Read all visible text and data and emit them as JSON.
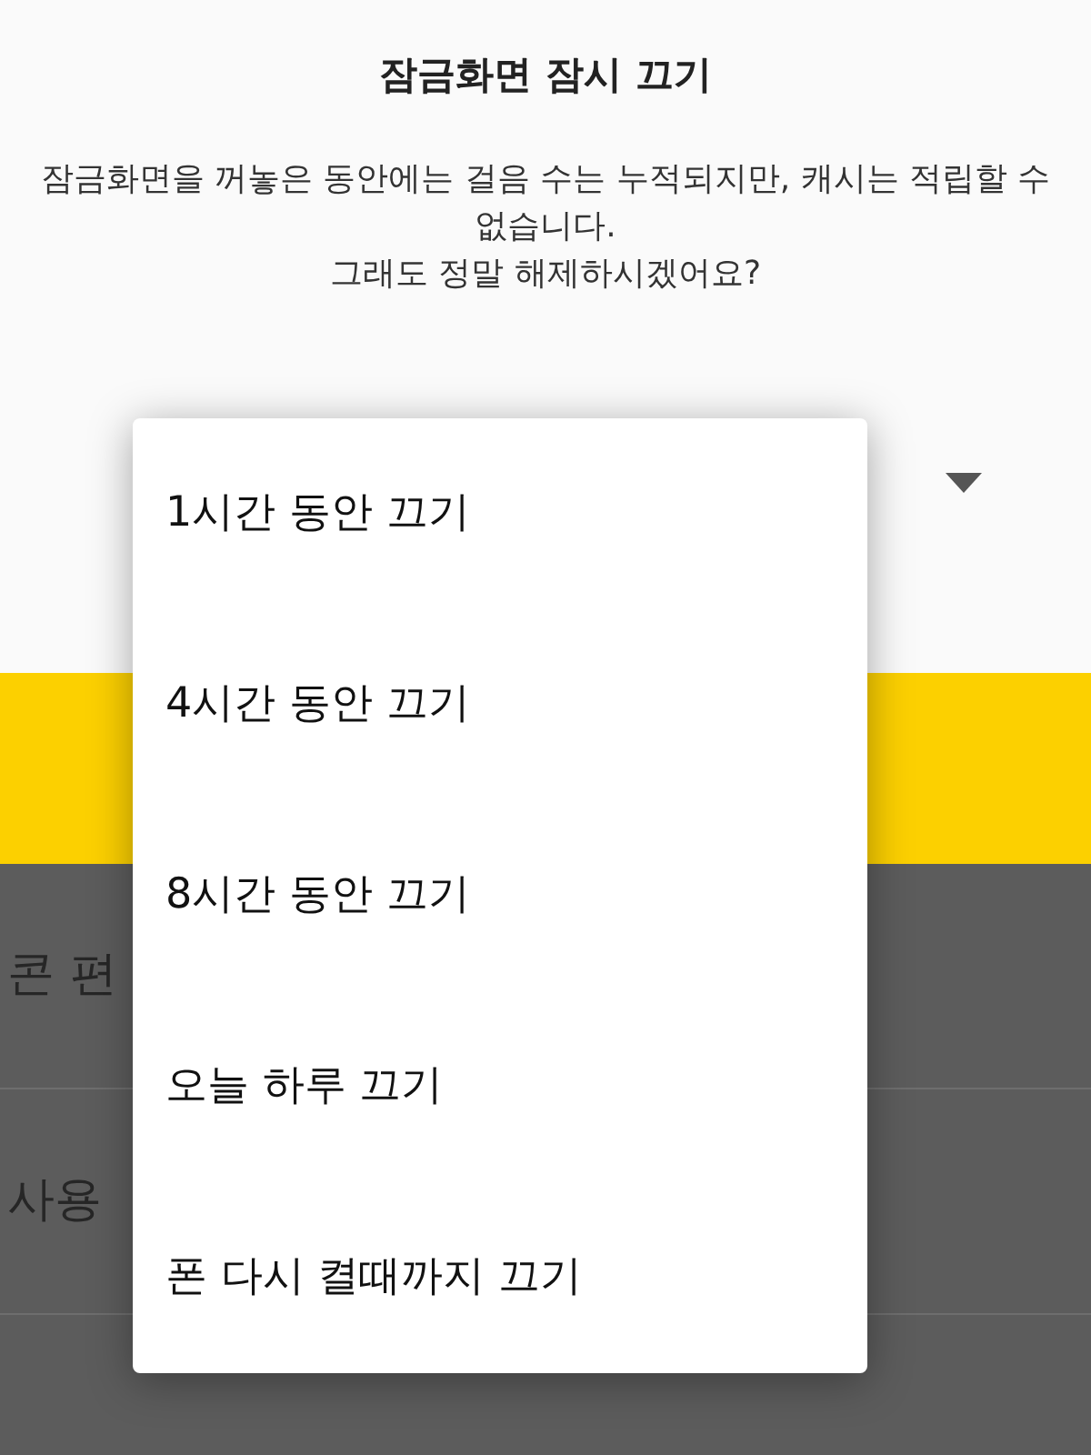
{
  "dialog": {
    "title": "잠금화면 잠시 끄기",
    "message_lines": [
      "잠금화면을 꺼놓은 동안에는 걸음 수는 누적되지만, 캐시는 적립할 수 없습니다.",
      "그래도 정말 해제하시겠어요?"
    ],
    "dropdown": {
      "expanded": true
    }
  },
  "dropdown_menu": [
    {
      "label": "1시간 동안 끄기"
    },
    {
      "label": "4시간 동안 끄기"
    },
    {
      "label": "8시간 동안 끄기"
    },
    {
      "label": "오늘 하루 끄기"
    },
    {
      "label": "폰 다시 켤때까지 끄기"
    }
  ],
  "background_rows": [
    {
      "label": "콘 편"
    },
    {
      "label": "사용"
    }
  ]
}
